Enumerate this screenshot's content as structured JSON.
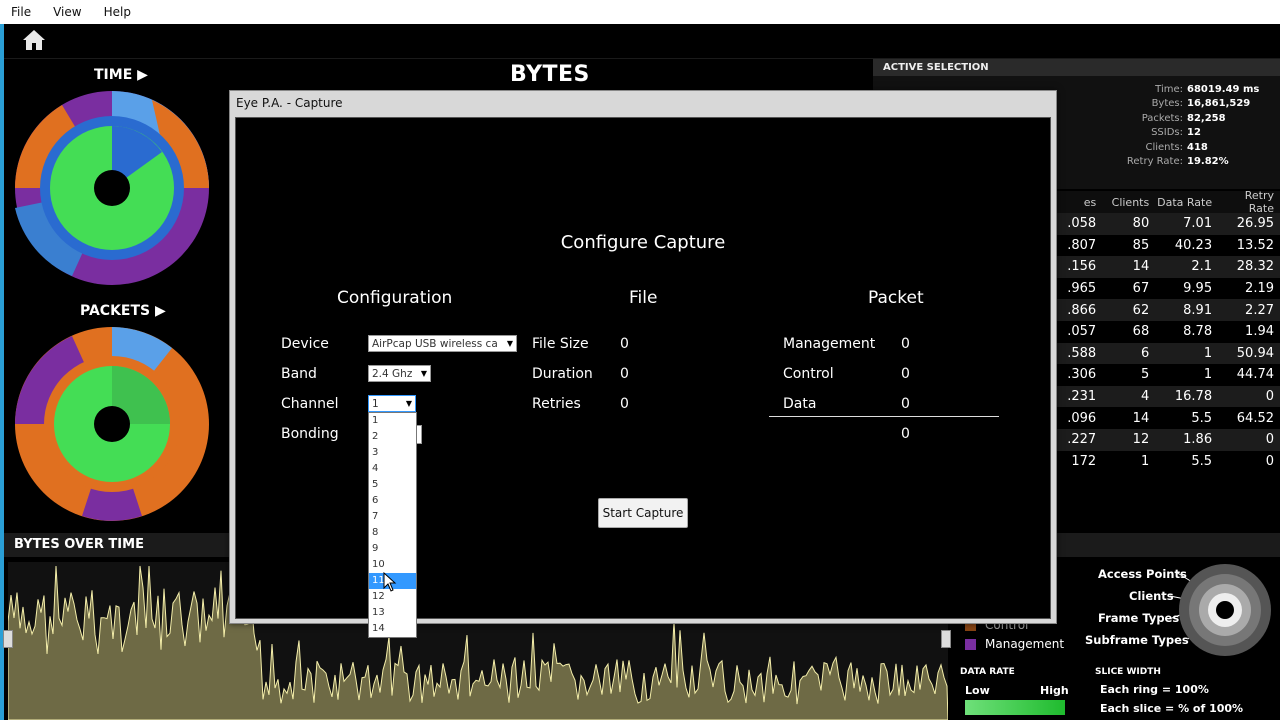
{
  "menu": {
    "file": "File",
    "view": "View",
    "help": "Help"
  },
  "left": {
    "time_title": "TIME",
    "packets_title": "PACKETS"
  },
  "main": {
    "bytes_title": "BYTES"
  },
  "active_selection": {
    "title": "ACTIVE SELECTION",
    "rows": [
      {
        "k": "Time:",
        "v": "68019.49 ms"
      },
      {
        "k": "Bytes:",
        "v": "16,861,529"
      },
      {
        "k": "Packets:",
        "v": "82,258"
      },
      {
        "k": "SSIDs:",
        "v": "12"
      },
      {
        "k": "Clients:",
        "v": "418"
      },
      {
        "k": "Retry Rate:",
        "v": "19.82%"
      }
    ]
  },
  "table": {
    "headers": [
      "es",
      "Clients",
      "Data Rate",
      "Retry Rate"
    ],
    "rows": [
      [
        ".058",
        "80",
        "7.01",
        "26.95"
      ],
      [
        ".807",
        "85",
        "40.23",
        "13.52"
      ],
      [
        ".156",
        "14",
        "2.1",
        "28.32"
      ],
      [
        ".965",
        "67",
        "9.95",
        "2.19"
      ],
      [
        ".866",
        "62",
        "8.91",
        "2.27"
      ],
      [
        ".057",
        "68",
        "8.78",
        "1.94"
      ],
      [
        ".588",
        "6",
        "1",
        "50.94"
      ],
      [
        ".306",
        "5",
        "1",
        "44.74"
      ],
      [
        ".231",
        "4",
        "16.78",
        "0"
      ],
      [
        ".096",
        "14",
        "5.5",
        "64.52"
      ],
      [
        ".227",
        "12",
        "1.86",
        "0"
      ],
      [
        "172",
        "1",
        "5.5",
        "0"
      ]
    ]
  },
  "bottom": {
    "bytes_over_time": "BYTES OVER TIME"
  },
  "legend": {
    "control": "Control",
    "management": "Management",
    "control_color": "#e07020",
    "management_color": "#7a2ea0"
  },
  "data_rate": {
    "title": "DATA RATE",
    "low": "Low",
    "high": "High"
  },
  "rings": {
    "access_points": "Access Points",
    "clients": "Clients",
    "frame_types": "Frame Types",
    "subframe_types": "Subframe Types"
  },
  "slice_width": {
    "title": "SLICE WIDTH",
    "ring": "Each ring = 100%",
    "slice": "Each slice = % of 100%"
  },
  "dialog": {
    "title": "Eye P.A. - Capture",
    "heading": "Configure Capture",
    "configuration": {
      "title": "Configuration",
      "device_label": "Device",
      "device_value": "AirPcap USB wireless ca",
      "band_label": "Band",
      "band_value": "2.4 Ghz",
      "channel_label": "Channel",
      "channel_value": "1",
      "bonding_label": "Bonding",
      "channel_options": [
        "1",
        "2",
        "3",
        "4",
        "5",
        "6",
        "7",
        "8",
        "9",
        "10",
        "11",
        "12",
        "13",
        "14"
      ]
    },
    "file": {
      "title": "File",
      "size_label": "File Size",
      "size_value": "0",
      "duration_label": "Duration",
      "duration_value": "0",
      "retries_label": "Retries",
      "retries_value": "0"
    },
    "packet": {
      "title": "Packet",
      "management_label": "Management",
      "management_value": "0",
      "control_label": "Control",
      "control_value": "0",
      "data_label": "Data",
      "data_value": "0",
      "total_value": "0"
    },
    "start_button": "Start Capture"
  },
  "icons": {
    "home": "home-icon",
    "arrow": "triangle-right-icon"
  }
}
